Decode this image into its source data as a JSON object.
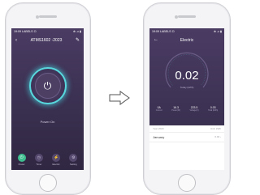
{
  "left_phone": {
    "status_left": "19:09 LABELS ⊡",
    "status_right": "⊕ ⊿ ▮",
    "title": "ATMS1602 -2023",
    "power_label": "Power On",
    "tabs": [
      {
        "label": "Power",
        "icon": "power-icon",
        "glyph": "⏻",
        "active": true
      },
      {
        "label": "Timer",
        "icon": "timer-icon",
        "glyph": "◷",
        "active": false
      },
      {
        "label": "Electric",
        "icon": "electric-icon",
        "glyph": "⚡",
        "active": false
      },
      {
        "label": "Setting",
        "icon": "setting-icon",
        "glyph": "⚙",
        "active": false
      }
    ]
  },
  "right_phone": {
    "status_left": "19:09 LABELS ⊡",
    "status_right": "⊕ ⊿ ▮",
    "title": "Electric",
    "gauge_value": "0.02",
    "gauge_unit": "Today (kWh)",
    "stats": [
      {
        "value": "0A",
        "label": "Current"
      },
      {
        "value": "16.3",
        "label": "Power(W)"
      },
      {
        "value": "223.5",
        "label": "Voltage(V)"
      },
      {
        "value": "0.03",
        "label": "Total (kWh)"
      }
    ],
    "list_header_left": "Year 2023",
    "list_header_right": "Unit: kWh",
    "rows": [
      {
        "month": "January",
        "value": "0.02 ›"
      }
    ]
  },
  "colors": {
    "screen_bg": "#3f3356",
    "ring": "#58d7dd",
    "active_tab": "#3fbf8f"
  }
}
